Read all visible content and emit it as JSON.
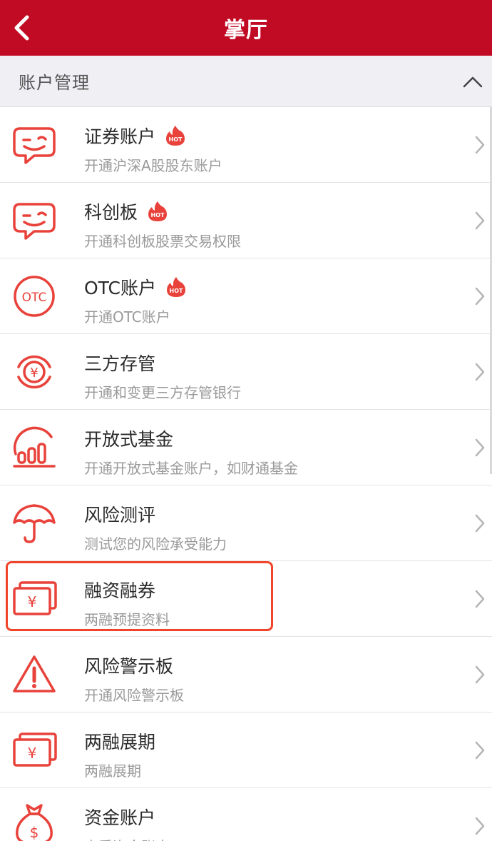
{
  "header": {
    "title": "掌厅",
    "back_icon": "chevron-left-icon"
  },
  "section": {
    "title": "账户管理",
    "state_icon": "chevron-up-icon"
  },
  "theme": {
    "brand": "#c10b24",
    "accent": "#e8423b",
    "highlight": "#f0452a"
  },
  "hot_label": "HOT",
  "items": [
    {
      "title": "证券账户",
      "subtitle": "开通沪深A股股东账户",
      "hot": true,
      "icon": "smile-chat-icon"
    },
    {
      "title": "科创板",
      "subtitle": "开通科创板股票交易权限",
      "hot": true,
      "icon": "smile-chat-icon"
    },
    {
      "title": "OTC账户",
      "subtitle": "开通OTC账户",
      "hot": true,
      "icon": "otc-circle-icon",
      "icon_text": "OTC"
    },
    {
      "title": "三方存管",
      "subtitle": "开通和变更三方存管银行",
      "hot": false,
      "icon": "yen-circle-icon",
      "icon_text": "¥"
    },
    {
      "title": "开放式基金",
      "subtitle": "开通开放式基金账户，如财通基金",
      "hot": false,
      "icon": "bar-growth-icon"
    },
    {
      "title": "风险测评",
      "subtitle": "测试您的风险承受能力",
      "hot": false,
      "icon": "umbrella-icon"
    },
    {
      "title": "融资融券",
      "subtitle": "两融预提资料",
      "hot": false,
      "icon": "yen-cards-icon",
      "icon_text": "¥"
    },
    {
      "title": "风险警示板",
      "subtitle": "开通风险警示板",
      "hot": false,
      "icon": "warning-triangle-icon"
    },
    {
      "title": "两融展期",
      "subtitle": "两融展期",
      "hot": false,
      "icon": "yen-cards-icon",
      "icon_text": "¥"
    },
    {
      "title": "资金账户",
      "subtitle": "查看资金账户",
      "hot": false,
      "icon": "money-bag-icon",
      "icon_text": "$"
    }
  ]
}
